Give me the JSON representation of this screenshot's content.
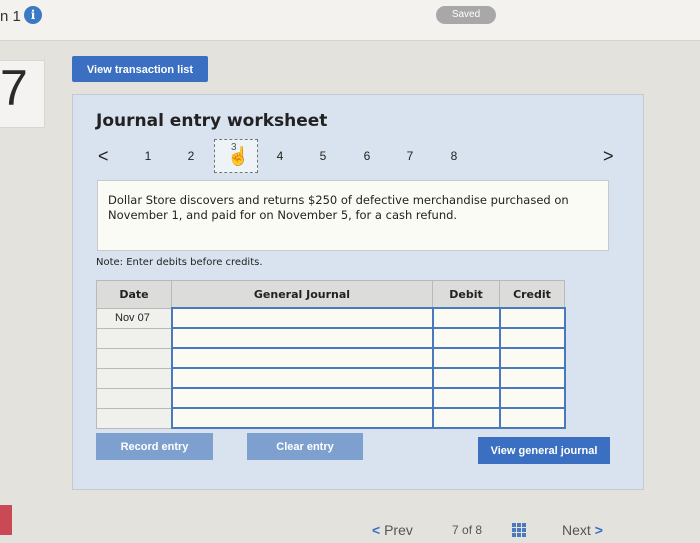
{
  "header": {
    "question_label": "n 1",
    "info_icon": "i",
    "saved_label": "Saved"
  },
  "question_number": "7",
  "view_transaction_label": "View transaction list",
  "worksheet": {
    "title": "Journal entry worksheet",
    "prev_arrow": "<",
    "next_arrow": ">",
    "pages": [
      "1",
      "2",
      "3",
      "4",
      "5",
      "6",
      "7",
      "8"
    ],
    "active_page": "3",
    "description": "Dollar Store discovers and returns $250 of defective merchandise purchased on November 1, and paid for on November 5, for a cash refund.",
    "note": "Note: Enter debits before credits."
  },
  "journal": {
    "headers": [
      "Date",
      "General Journal",
      "Debit",
      "Credit"
    ],
    "rows": [
      {
        "date": "Nov 07",
        "account": "",
        "debit": "",
        "credit": ""
      },
      {
        "date": "",
        "account": "",
        "debit": "",
        "credit": ""
      },
      {
        "date": "",
        "account": "",
        "debit": "",
        "credit": ""
      },
      {
        "date": "",
        "account": "",
        "debit": "",
        "credit": ""
      },
      {
        "date": "",
        "account": "",
        "debit": "",
        "credit": ""
      },
      {
        "date": "",
        "account": "",
        "debit": "",
        "credit": ""
      }
    ]
  },
  "buttons": {
    "record": "Record entry",
    "clear": "Clear entry",
    "view_general_journal": "View general journal"
  },
  "footer": {
    "prev_label": "Prev",
    "page_current": "7",
    "page_of": "of",
    "page_total": "8",
    "next_label": "Next"
  },
  "colors": {
    "accent": "#3a6fc1",
    "panel": "#d9e3ef",
    "input_border": "#4a79bd",
    "badge": "#a8a8a8"
  }
}
